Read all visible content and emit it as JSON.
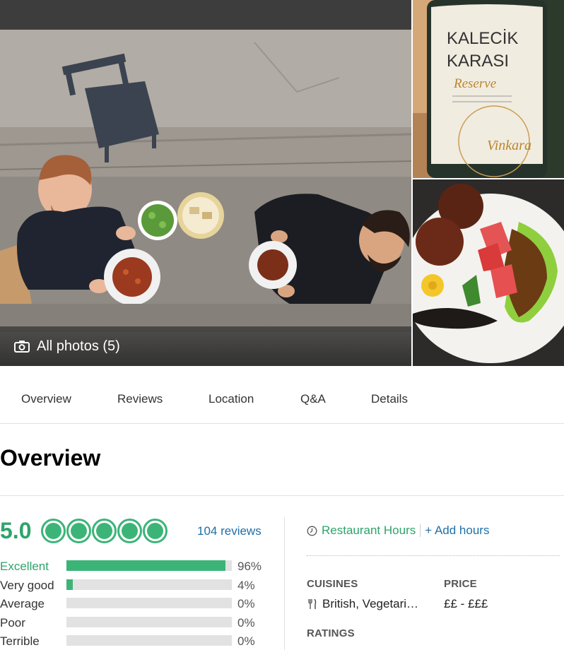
{
  "gallery": {
    "photos_label": "All photos (5)",
    "camera_icon": "camera-icon",
    "wine_label": {
      "line1": "KALECİK",
      "line2": "KARASI",
      "line3": "Reserve",
      "brand": "Vinkara"
    }
  },
  "tabs": [
    {
      "label": "Overview"
    },
    {
      "label": "Reviews"
    },
    {
      "label": "Location"
    },
    {
      "label": "Q&A"
    },
    {
      "label": "Details"
    }
  ],
  "overview": {
    "title": "Overview",
    "rating": "5.0",
    "bubbles_filled": 5,
    "reviews_link": "104 reviews",
    "breakdown": [
      {
        "label": "Excellent",
        "pct": "96%",
        "value": 96,
        "highlight": true
      },
      {
        "label": "Very good",
        "pct": "4%",
        "value": 4,
        "highlight": false
      },
      {
        "label": "Average",
        "pct": "0%",
        "value": 0,
        "highlight": false
      },
      {
        "label": "Poor",
        "pct": "0%",
        "value": 0,
        "highlight": false
      },
      {
        "label": "Terrible",
        "pct": "0%",
        "value": 0,
        "highlight": false
      }
    ]
  },
  "details": {
    "hours_link": "Restaurant Hours",
    "add_hours": "+ Add hours",
    "cuisines_caption": "CUISINES",
    "cuisines_value": "British, Vegetari…",
    "price_caption": "PRICE",
    "price_value": "££ - £££",
    "ratings_caption": "RATINGS"
  },
  "colors": {
    "accent_green": "#3cb478",
    "link_blue": "#1f6fa8",
    "track_gray": "#e2e2e2"
  }
}
